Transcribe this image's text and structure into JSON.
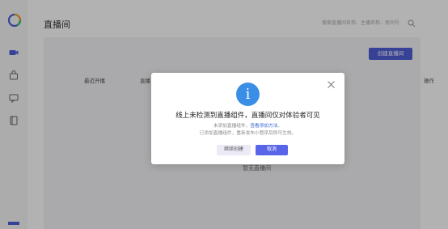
{
  "page": {
    "title": "直播间",
    "search_placeholder": "搜索直播间名称、主播名称、房间号"
  },
  "toolbar": {
    "create_label": "创建直播间"
  },
  "table": {
    "headers": [
      "最近开播",
      "直播",
      "操作"
    ],
    "empty_text": "暂无直播间"
  },
  "sidebar": {
    "items": [
      {
        "icon": "video-icon",
        "active": true
      },
      {
        "icon": "bag-icon",
        "active": false
      },
      {
        "icon": "chat-icon",
        "active": false
      },
      {
        "icon": "book-icon",
        "active": false
      }
    ]
  },
  "modal": {
    "icon_text": "i",
    "title": "线上未检测到直播组件，直播间仅对体验者可见",
    "desc1_prefix": "未添加直播组件，",
    "desc1_link": "查看添加方法",
    "desc1_suffix": "。",
    "desc2": "已添加直播组件，重新发布小程序后即可生效。",
    "secondary_button": "继续创建",
    "primary_button": "取消"
  },
  "colors": {
    "accent": "#5865e8",
    "info_icon": "#3a8ee6",
    "link": "#3a64d8",
    "sidebar_active": "#4f5fd8"
  }
}
